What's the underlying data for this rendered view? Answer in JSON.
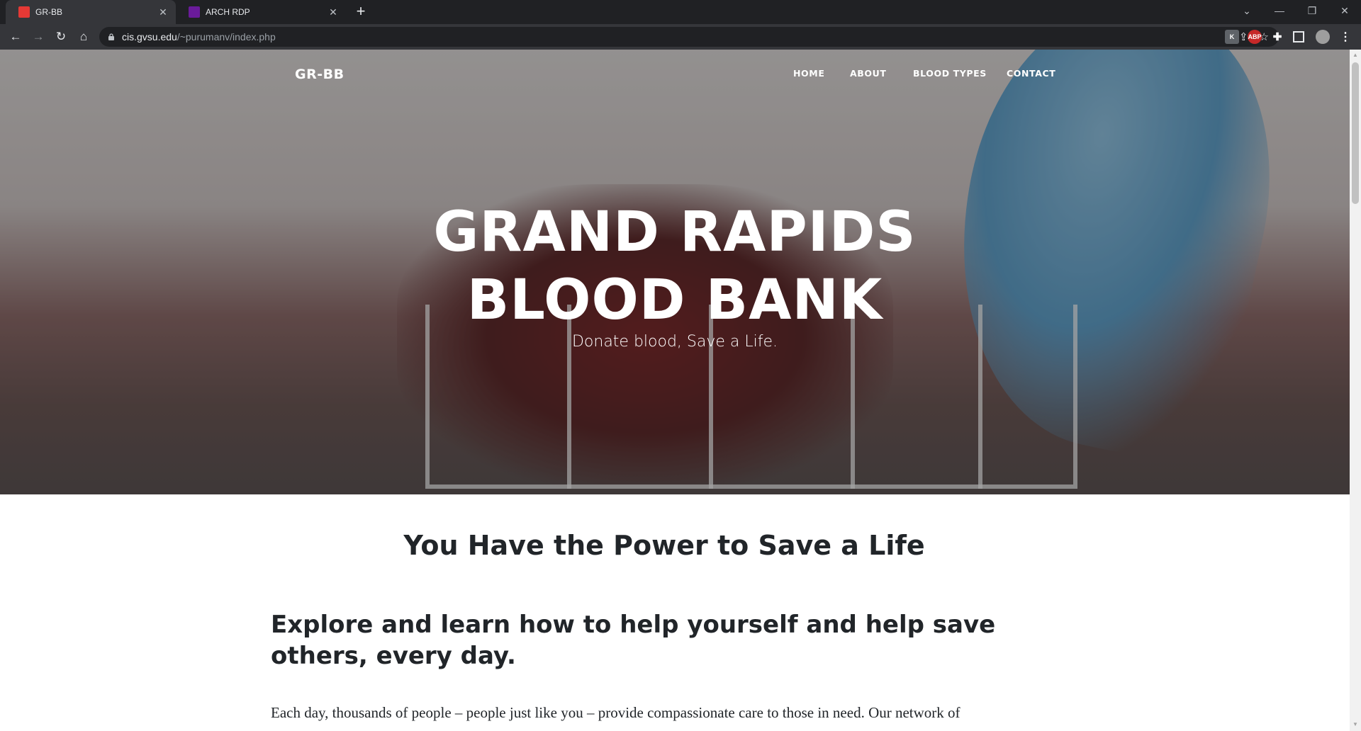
{
  "browser": {
    "tabs": [
      {
        "title": "GR-BB",
        "favicon_color": "#e53935",
        "active": true
      },
      {
        "title": "ARCH RDP",
        "favicon_color": "#7b1fa2",
        "active": false
      }
    ],
    "url_host": "cis.gvsu.edu",
    "url_path": "/~purumanv/index.php"
  },
  "site": {
    "brand": "GR-BB",
    "nav": [
      {
        "label": "HOME"
      },
      {
        "label": "ABOUT"
      },
      {
        "label": "BLOOD TYPES"
      },
      {
        "label": "CONTACT"
      }
    ],
    "hero_title_line1": "GRAND RAPIDS",
    "hero_title_line2": "BLOOD BANK",
    "hero_subtitle": "Donate blood, Save a Life."
  },
  "content": {
    "title": "You Have the Power to Save a Life",
    "subtitle": "Explore and learn how to help yourself and help save others, every day.",
    "paragraph": "Each day, thousands of people – people just like you – provide compassionate care to those in need. Our network of"
  }
}
